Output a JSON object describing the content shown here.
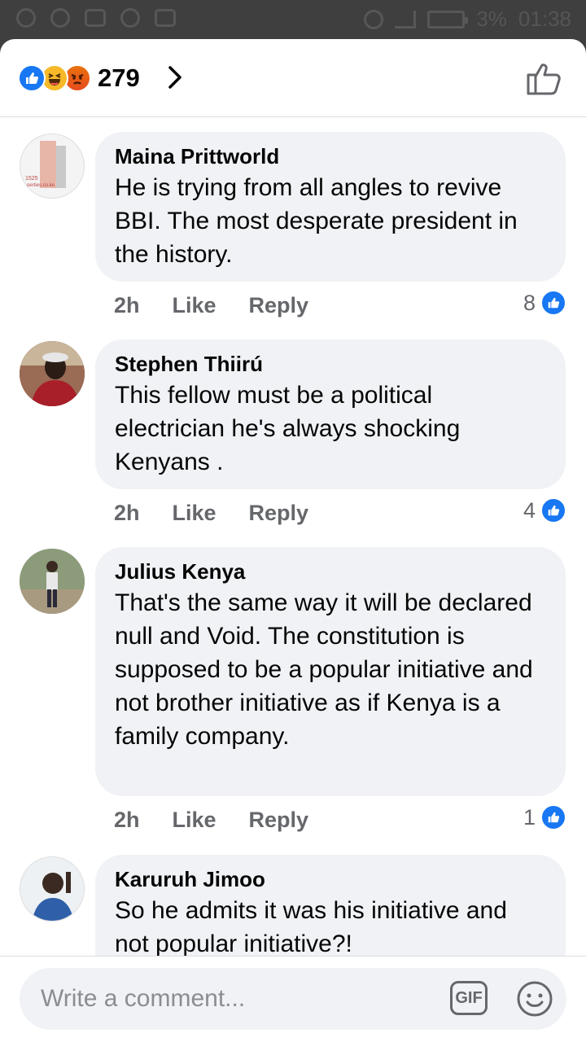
{
  "status_bar": {
    "battery": "3%",
    "time": "01:38"
  },
  "header": {
    "reaction_count": "279",
    "reactions": [
      "like-icon",
      "haha-icon",
      "angry-icon"
    ]
  },
  "comments": [
    {
      "author": "Maina Prittworld",
      "text": "He is trying from all angles to revive BBI. The most desperate president in the history.",
      "time": "2h",
      "like_label": "Like",
      "reply_label": "Reply",
      "likes": "8"
    },
    {
      "author": "Stephen Thiirú",
      "text": "This fellow must be a political electrician he's always shocking Kenyans .",
      "time": "2h",
      "like_label": "Like",
      "reply_label": "Reply",
      "likes": "4"
    },
    {
      "author": "Julius Kenya",
      "text": "That's the same way it will be declared null and Void. The constitution is supposed to be a popular initiative and not brother initiative as if Kenya is a family company.",
      "time": "2h",
      "like_label": "Like",
      "reply_label": "Reply",
      "likes": "1"
    },
    {
      "author": "Karuruh Jimoo",
      "text": "So he admits it was his initiative and not popular initiative?!"
    }
  ],
  "composer": {
    "placeholder": "Write a comment...",
    "gif_label": "GIF"
  },
  "colors": {
    "accent": "#1877f2",
    "bubble": "#f0f2f5",
    "meta_text": "#65676b"
  }
}
